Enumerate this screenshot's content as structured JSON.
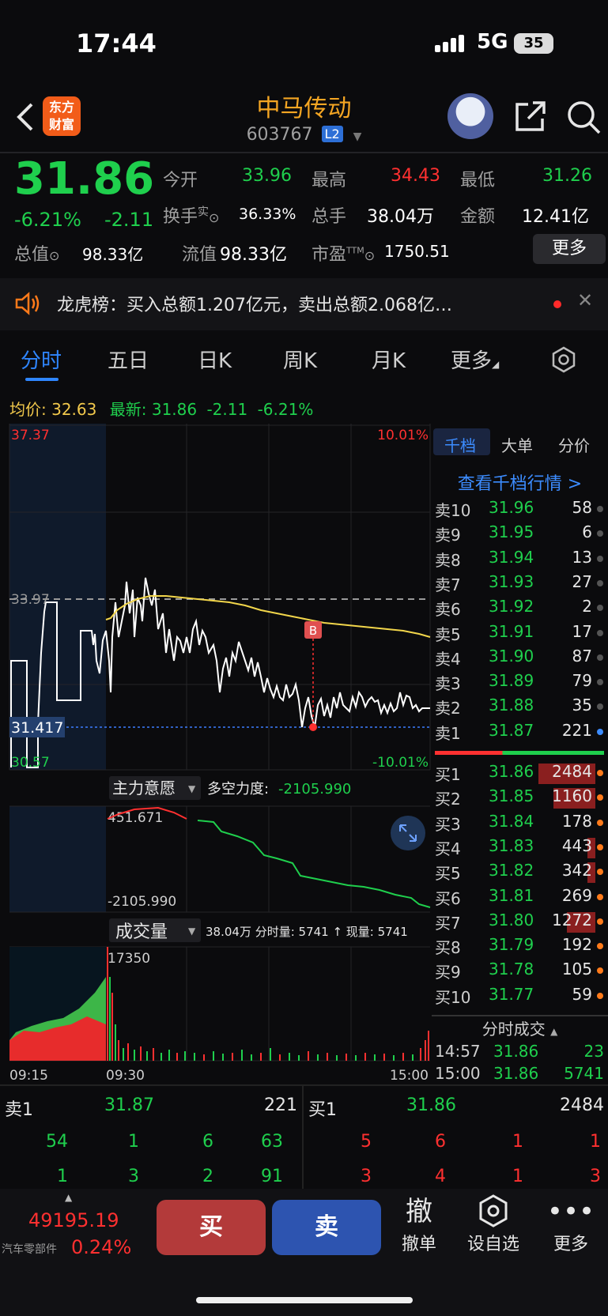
{
  "status": {
    "time": "17:44",
    "network": "5G",
    "battery": "35"
  },
  "header": {
    "logo_line1": "东方",
    "logo_line2": "财富",
    "name": "中马传动",
    "code": "603767",
    "level_badge": "L2"
  },
  "quote": {
    "price": "31.86",
    "change_pct": "-6.21%",
    "change_amt": "-2.11",
    "open_label": "今开",
    "open": "33.96",
    "high_label": "最高",
    "high": "34.43",
    "low_label": "最低",
    "low": "31.26",
    "turnover_label": "换手",
    "turnover_sup": "实",
    "turnover": "36.33%",
    "volume_label": "总手",
    "volume": "38.04万",
    "amount_label": "金额",
    "amount": "12.41亿",
    "mcap_label": "总值",
    "mcap": "98.33亿",
    "float_label": "流值",
    "float": "98.33亿",
    "pe_label": "市盈",
    "pe_sup": "TTM",
    "pe": "1750.51",
    "more": "更多"
  },
  "notice": {
    "text": "龙虎榜：买入总额1.207亿元，卖出总额2.068亿…"
  },
  "tabs": [
    "分时",
    "五日",
    "日K",
    "周K",
    "月K",
    "更多"
  ],
  "avg_row": {
    "avg_label": "均价:",
    "avg": "32.63",
    "last_label": "最新:",
    "last": "31.86",
    "chg": "-2.11",
    "pct": "-6.21%"
  },
  "chart": {
    "y_top": "37.37",
    "y_top_pct": "10.01%",
    "y_ref": "33.97",
    "y_cur": "31.417",
    "y_bot": "30.57",
    "y_bot_pct": "-10.01%",
    "marker": "B",
    "indicator_label": "主力意愿",
    "indicator_value_label": "多空力度:",
    "indicator_value": "-2105.990",
    "ind_top": "451.671",
    "ind_bot": "-2105.990",
    "volume_label": "成交量",
    "volume_info": "38.04万 分时量: 5741 ↑ 现量: 5741",
    "vol_max": "17350",
    "t_start": "09:15",
    "t_open": "09:30",
    "t_end": "15:00",
    "colors": {
      "line": "#ffffff",
      "avg": "#f2d64b",
      "up": "#ff3030",
      "down": "#1fcf4d"
    }
  },
  "chart_data": {
    "type": "line",
    "title": "",
    "x": [
      "09:15",
      "09:30",
      "15:00"
    ],
    "series": [],
    "ylim": [
      30.57,
      37.37
    ]
  },
  "orderbook": {
    "tabs": [
      "千档",
      "大单",
      "分价"
    ],
    "link": "查看千档行情 >",
    "sell": [
      {
        "label": "卖10",
        "price": "31.96",
        "vol": "58"
      },
      {
        "label": "卖9",
        "price": "31.95",
        "vol": "6"
      },
      {
        "label": "卖8",
        "price": "31.94",
        "vol": "13"
      },
      {
        "label": "卖7",
        "price": "31.93",
        "vol": "27"
      },
      {
        "label": "卖6",
        "price": "31.92",
        "vol": "2"
      },
      {
        "label": "卖5",
        "price": "31.91",
        "vol": "17"
      },
      {
        "label": "卖4",
        "price": "31.90",
        "vol": "87"
      },
      {
        "label": "卖3",
        "price": "31.89",
        "vol": "79"
      },
      {
        "label": "卖2",
        "price": "31.88",
        "vol": "35"
      },
      {
        "label": "卖1",
        "price": "31.87",
        "vol": "221"
      }
    ],
    "buy": [
      {
        "label": "买1",
        "price": "31.86",
        "vol": "2484"
      },
      {
        "label": "买2",
        "price": "31.85",
        "vol": "1160"
      },
      {
        "label": "买3",
        "price": "31.84",
        "vol": "178"
      },
      {
        "label": "买4",
        "price": "31.83",
        "vol": "443"
      },
      {
        "label": "买5",
        "price": "31.82",
        "vol": "342"
      },
      {
        "label": "买6",
        "price": "31.81",
        "vol": "269"
      },
      {
        "label": "买7",
        "price": "31.80",
        "vol": "1272"
      },
      {
        "label": "买8",
        "price": "31.79",
        "vol": "192"
      },
      {
        "label": "买9",
        "price": "31.78",
        "vol": "105"
      },
      {
        "label": "买10",
        "price": "31.77",
        "vol": "59"
      }
    ],
    "tick_title": "分时成交",
    "ticks": [
      {
        "time": "14:57",
        "price": "31.86",
        "vol": "23"
      },
      {
        "time": "15:00",
        "price": "31.86",
        "vol": "5741"
      }
    ]
  },
  "bottom_quote": {
    "sell_label": "卖1",
    "sell_price": "31.87",
    "sell_vol": "221",
    "buy_label": "买1",
    "buy_price": "31.86",
    "buy_vol": "2484",
    "sell_row1": [
      "54",
      "1",
      "6",
      "63"
    ],
    "sell_row2": [
      "1",
      "3",
      "2",
      "91"
    ],
    "buy_row1": [
      "5",
      "6",
      "1",
      "1"
    ],
    "buy_row2": [
      "3",
      "4",
      "1",
      "3"
    ]
  },
  "footer": {
    "index_value": "49195.19",
    "index_name": "汽车零部件",
    "index_pct": "0.24%",
    "buy": "买",
    "sell": "卖",
    "cancel_icon": "撤",
    "cancel": "撤单",
    "watch": "设自选",
    "more": "更多"
  }
}
